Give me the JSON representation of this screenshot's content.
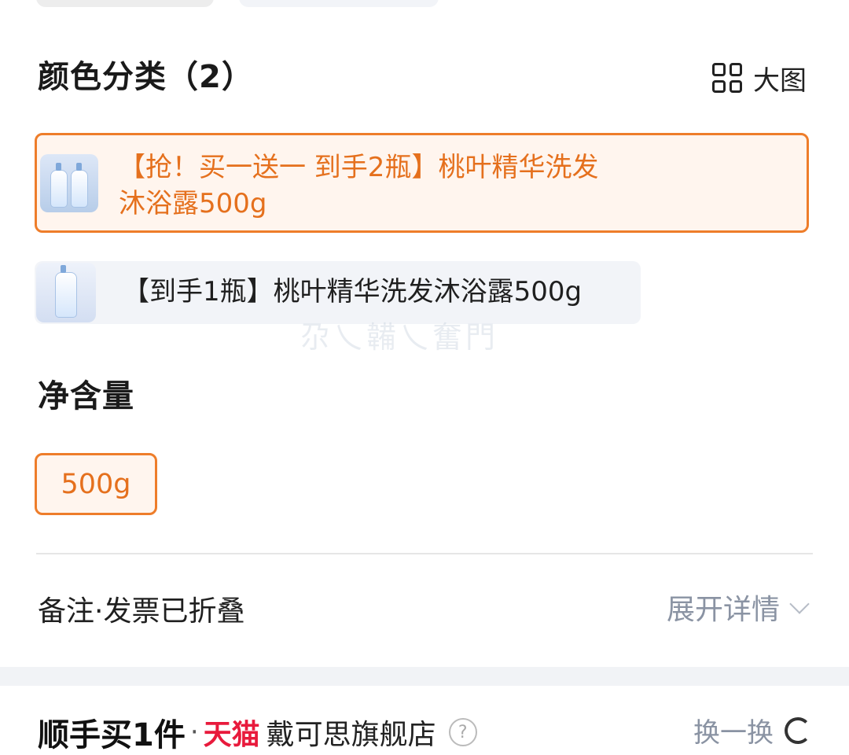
{
  "color_section": {
    "title": "颜色分类（2）",
    "view_toggle_label": "大图",
    "options": [
      {
        "label": "【抢！买一送一 到手2瓶】桃叶精华洗发沐浴露500g",
        "selected": true
      },
      {
        "label": "【到手1瓶】桃叶精华洗发沐浴露500g",
        "selected": false
      }
    ]
  },
  "watermark": "尕乀韛乀奮門",
  "net_section": {
    "title": "净含量",
    "options": [
      {
        "label": "500g",
        "selected": true
      }
    ]
  },
  "notes_row": {
    "label": "备注·发票已折叠",
    "expand_label": "展开详情"
  },
  "addon_section": {
    "title": "顺手买1件",
    "separator": "·",
    "platform_badge": "天猫",
    "store_name": "戴可思旗舰店",
    "help_glyph": "?",
    "refresh_label": "换一换"
  },
  "colors": {
    "accent": "#ee7d2a",
    "accent_text": "#e5701d",
    "selected_bg": "#fff5ee",
    "option_bg": "#f2f4f8",
    "muted_text": "#8a93a3",
    "tmall_red": "#e81a3c"
  }
}
